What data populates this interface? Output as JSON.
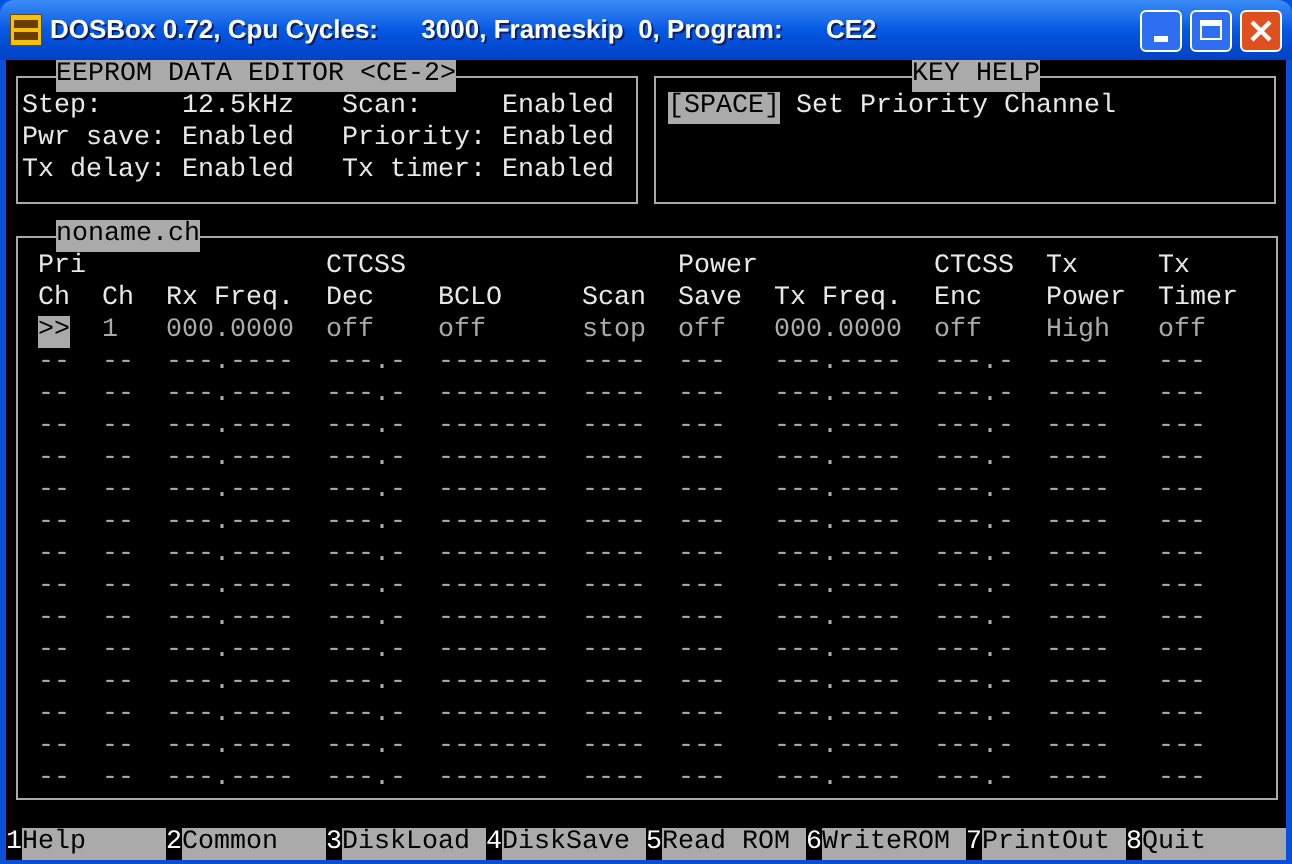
{
  "window": {
    "title": "DOSBox 0.72, Cpu Cycles:      3000, Frameskip  0, Program:      CE2"
  },
  "editor_panel": {
    "title": "EEPROM DATA EDITOR <CE-2>",
    "settings": [
      {
        "label": "Step:",
        "value": "12.5kHz"
      },
      {
        "label": "Scan:",
        "value": "Enabled"
      },
      {
        "label": "Pwr save:",
        "value": "Enabled"
      },
      {
        "label": "Priority:",
        "value": "Enabled"
      },
      {
        "label": "Tx delay:",
        "value": "Enabled"
      },
      {
        "label": "Tx timer:",
        "value": "Enabled"
      }
    ]
  },
  "key_help": {
    "title": "KEY HELP",
    "entries": [
      {
        "key": "[SPACE]",
        "description": "Set Priority Channel"
      }
    ]
  },
  "channel_table": {
    "file": "noname.ch",
    "columns": [
      "Pri\nCh",
      "Ch",
      "Rx Freq.",
      "CTCSS\nDec",
      "BCLO",
      "Scan",
      "Power\nSave",
      "Tx Freq.",
      "CTCSS\nEnc",
      "Tx\nPower",
      "Tx\nTimer"
    ],
    "rows": [
      {
        "priority": true,
        "cells": [
          ">>",
          "1",
          "000.0000",
          "off",
          "off",
          "stop",
          "off",
          "000.0000",
          "off",
          "High",
          "off"
        ]
      },
      {
        "priority": false,
        "cells": [
          "--",
          "--",
          "---.----",
          "---.-",
          "-------",
          "----",
          "---",
          "---.----",
          "---.-",
          "----",
          "---"
        ]
      },
      {
        "priority": false,
        "cells": [
          "--",
          "--",
          "---.----",
          "---.-",
          "-------",
          "----",
          "---",
          "---.----",
          "---.-",
          "----",
          "---"
        ]
      },
      {
        "priority": false,
        "cells": [
          "--",
          "--",
          "---.----",
          "---.-",
          "-------",
          "----",
          "---",
          "---.----",
          "---.-",
          "----",
          "---"
        ]
      },
      {
        "priority": false,
        "cells": [
          "--",
          "--",
          "---.----",
          "---.-",
          "-------",
          "----",
          "---",
          "---.----",
          "---.-",
          "----",
          "---"
        ]
      },
      {
        "priority": false,
        "cells": [
          "--",
          "--",
          "---.----",
          "---.-",
          "-------",
          "----",
          "---",
          "---.----",
          "---.-",
          "----",
          "---"
        ]
      },
      {
        "priority": false,
        "cells": [
          "--",
          "--",
          "---.----",
          "---.-",
          "-------",
          "----",
          "---",
          "---.----",
          "---.-",
          "----",
          "---"
        ]
      },
      {
        "priority": false,
        "cells": [
          "--",
          "--",
          "---.----",
          "---.-",
          "-------",
          "----",
          "---",
          "---.----",
          "---.-",
          "----",
          "---"
        ]
      },
      {
        "priority": false,
        "cells": [
          "--",
          "--",
          "---.----",
          "---.-",
          "-------",
          "----",
          "---",
          "---.----",
          "---.-",
          "----",
          "---"
        ]
      },
      {
        "priority": false,
        "cells": [
          "--",
          "--",
          "---.----",
          "---.-",
          "-------",
          "----",
          "---",
          "---.----",
          "---.-",
          "----",
          "---"
        ]
      },
      {
        "priority": false,
        "cells": [
          "--",
          "--",
          "---.----",
          "---.-",
          "-------",
          "----",
          "---",
          "---.----",
          "---.-",
          "----",
          "---"
        ]
      },
      {
        "priority": false,
        "cells": [
          "--",
          "--",
          "---.----",
          "---.-",
          "-------",
          "----",
          "---",
          "---.----",
          "---.-",
          "----",
          "---"
        ]
      },
      {
        "priority": false,
        "cells": [
          "--",
          "--",
          "---.----",
          "---.-",
          "-------",
          "----",
          "---",
          "---.----",
          "---.-",
          "----",
          "---"
        ]
      },
      {
        "priority": false,
        "cells": [
          "--",
          "--",
          "---.----",
          "---.-",
          "-------",
          "----",
          "---",
          "---.----",
          "---.-",
          "----",
          "---"
        ]
      },
      {
        "priority": false,
        "cells": [
          "--",
          "--",
          "---.----",
          "---.-",
          "-------",
          "----",
          "---",
          "---.----",
          "---.-",
          "----",
          "---"
        ]
      }
    ]
  },
  "function_keys": [
    {
      "number": "1",
      "label": "Help"
    },
    {
      "number": "2",
      "label": "Common"
    },
    {
      "number": "3",
      "label": "DiskLoad"
    },
    {
      "number": "4",
      "label": "DiskSave"
    },
    {
      "number": "5",
      "label": "Read ROM"
    },
    {
      "number": "6",
      "label": "WriteROM"
    },
    {
      "number": "7",
      "label": "PrintOut"
    },
    {
      "number": "8",
      "label": "Quit"
    }
  ]
}
